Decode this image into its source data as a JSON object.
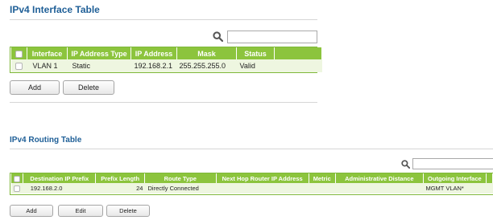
{
  "ipv4_interface": {
    "title": "IPv4 Interface Table",
    "columns": [
      "Interface",
      "IP Address Type",
      "IP Address",
      "Mask",
      "Status"
    ],
    "rows": [
      {
        "interface": "VLAN 1",
        "type": "Static",
        "ip": "192.168.2.1",
        "mask": "255.255.255.0",
        "status": "Valid"
      }
    ],
    "buttons": {
      "add": "Add",
      "delete": "Delete"
    }
  },
  "ipv4_routing": {
    "title": "IPv4 Routing Table",
    "columns": [
      "Destination IP Prefix",
      "Prefix Length",
      "Route Type",
      "Next Hop Router IP Address",
      "Metric",
      "Administrative Distance",
      "Outgoing Interface"
    ],
    "rows": [
      {
        "prefix": "192.168.2.0",
        "length": "24",
        "route_type": "Directly Connected",
        "next_hop": "",
        "metric": "",
        "distance": "",
        "outgoing": "MGMT VLAN*"
      }
    ],
    "buttons": {
      "add": "Add",
      "edit": "Edit",
      "delete": "Delete"
    }
  },
  "colors": {
    "header_green": "#8cc43d",
    "row_green": "#eef6e0",
    "title_blue": "#1f5f97"
  },
  "icons": {
    "search": "search-icon"
  }
}
